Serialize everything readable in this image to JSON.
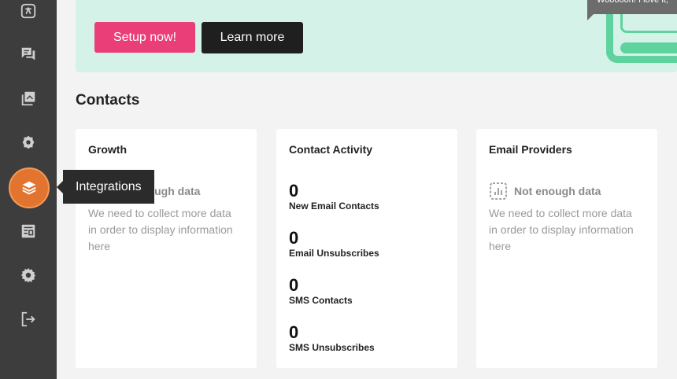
{
  "sidebar": {
    "items": [
      {
        "name": "translate-icon"
      },
      {
        "name": "chat-icon"
      },
      {
        "name": "gallery-icon"
      },
      {
        "name": "badge-icon"
      },
      {
        "name": "integrations-icon",
        "active": true
      },
      {
        "name": "forms-icon"
      },
      {
        "name": "settings-icon"
      },
      {
        "name": "logout-icon"
      }
    ],
    "tooltip": "Integrations"
  },
  "banner": {
    "buttons": {
      "setup": "Setup now!",
      "learn": "Learn more"
    },
    "speech_text": "Woooooh! I love it,"
  },
  "contacts": {
    "title": "Contacts",
    "cards": {
      "growth": {
        "title": "Growth",
        "empty_title": "Not enough data",
        "empty_text": "We need to collect more data in order to display information here"
      },
      "activity": {
        "title": "Contact Activity",
        "stats": [
          {
            "value": "0",
            "label": "New Email Contacts"
          },
          {
            "value": "0",
            "label": "Email Unsubscribes"
          },
          {
            "value": "0",
            "label": "SMS Contacts"
          },
          {
            "value": "0",
            "label": "SMS Unsubscribes"
          }
        ]
      },
      "providers": {
        "title": "Email Providers",
        "empty_title": "Not enough data",
        "empty_text": "We need to collect more data in order to display information here"
      }
    }
  },
  "colors": {
    "sidebar": "#3d3d3d",
    "accent_pink": "#ea3e78",
    "active_orange": "#e2742f",
    "banner_bg": "#d5f2e8",
    "illustration_green": "#5fd39e"
  }
}
